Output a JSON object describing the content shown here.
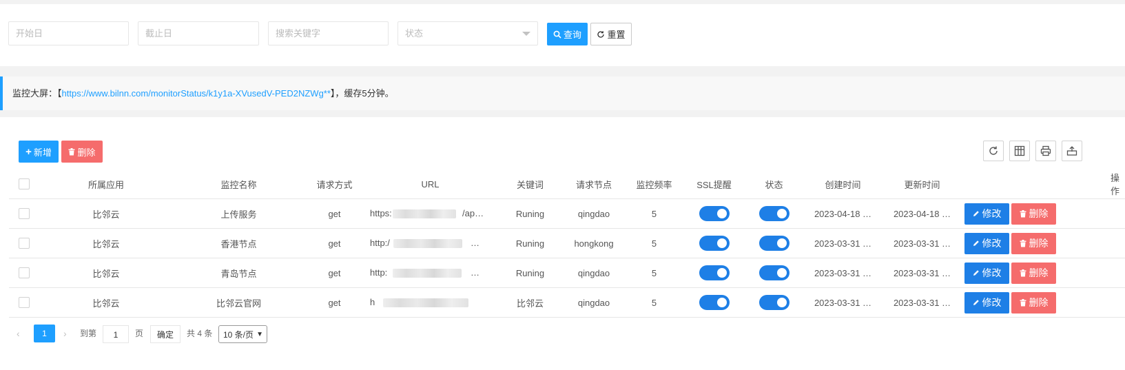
{
  "filter": {
    "start_placeholder": "开始日",
    "end_placeholder": "截止日",
    "keyword_placeholder": "搜索关键字",
    "status_placeholder": "状态",
    "search_label": "查询",
    "reset_label": "重置"
  },
  "notice": {
    "prefix": "监控大屏：【",
    "url": "https://www.bilnn.com/monitorStatus/k1y1a-XVusedV-PED2NZWg**",
    "suffix": "】，缓存5分钟。"
  },
  "toolbar": {
    "add_label": "新增",
    "delete_label": "删除"
  },
  "table": {
    "headers": [
      "所属应用",
      "监控名称",
      "请求方式",
      "URL",
      "关键词",
      "请求节点",
      "监控频率",
      "SSL提醒",
      "状态",
      "创建时间",
      "更新时间",
      "操作"
    ],
    "rows": [
      {
        "app": "比邻云",
        "name": "上传服务",
        "method": "get",
        "url_start": "https:",
        "url_end": "/ap…",
        "keyword": "Runing",
        "node": "qingdao",
        "freq": "5",
        "ssl": true,
        "status": true,
        "created": "2023-04-18 …",
        "updated": "2023-04-18 …"
      },
      {
        "app": "比邻云",
        "name": "香港节点",
        "method": "get",
        "url_start": "http:/",
        "url_end": "…",
        "keyword": "Runing",
        "node": "hongkong",
        "freq": "5",
        "ssl": true,
        "status": true,
        "created": "2023-03-31 …",
        "updated": "2023-03-31 …"
      },
      {
        "app": "比邻云",
        "name": "青岛节点",
        "method": "get",
        "url_start": "http:",
        "url_end": "…",
        "keyword": "Runing",
        "node": "qingdao",
        "freq": "5",
        "ssl": true,
        "status": true,
        "created": "2023-03-31 …",
        "updated": "2023-03-31 …"
      },
      {
        "app": "比邻云",
        "name": "比邻云官网",
        "method": "get",
        "url_start": "h",
        "url_end": "",
        "keyword": "比邻云",
        "node": "qingdao",
        "freq": "5",
        "ssl": true,
        "status": true,
        "created": "2023-03-31 …",
        "updated": "2023-03-31 …"
      }
    ],
    "edit_label": "修改",
    "delete_label": "删除"
  },
  "pager": {
    "current_page": "1",
    "goto_label": "到第",
    "goto_value": "1",
    "page_unit": "页",
    "confirm_label": "确定",
    "total_label": "共 4 条",
    "page_size": "10 条/页"
  },
  "colors": {
    "primary": "#1e9fff",
    "danger": "#f56c6c",
    "switch_on": "#1e7fe6"
  },
  "icons": {
    "search": "search-icon",
    "reset": "refresh-icon",
    "add": "plus-icon",
    "delete": "trash-icon",
    "edit": "pencil-icon",
    "refresh": "refresh-icon",
    "columns": "columns-icon",
    "print": "print-icon",
    "export": "export-icon"
  }
}
